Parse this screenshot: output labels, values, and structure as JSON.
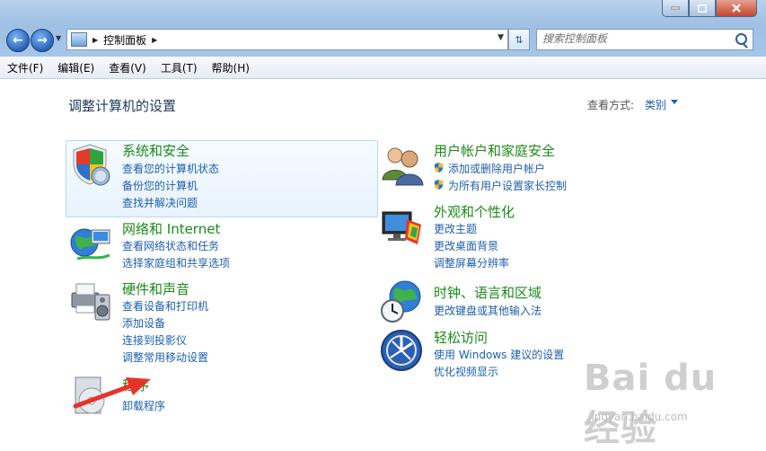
{
  "address": {
    "crumbs": [
      "控制面板"
    ]
  },
  "search": {
    "placeholder": "搜索控制面板"
  },
  "menu": [
    "文件(F)",
    "编辑(E)",
    "查看(V)",
    "工具(T)",
    "帮助(H)"
  ],
  "page": {
    "title": "调整计算机的设置",
    "view_by_label": "查看方式:",
    "view_by_value": "类别"
  },
  "categories": [
    {
      "title": "系统和安全",
      "links": [
        "查看您的计算机状态",
        "备份您的计算机",
        "查找并解决问题"
      ]
    },
    {
      "title": "网络和 Internet",
      "links": [
        "查看网络状态和任务",
        "选择家庭组和共享选项"
      ]
    },
    {
      "title": "硬件和声音",
      "links": [
        "查看设备和打印机",
        "添加设备",
        "连接到投影仪",
        "调整常用移动设置"
      ]
    },
    {
      "title": "程序",
      "links": [
        "卸载程序"
      ]
    },
    {
      "title": "用户帐户和家庭安全",
      "links": [
        "添加或删除用户帐户",
        "为所有用户设置家长控制"
      ]
    },
    {
      "title": "外观和个性化",
      "links": [
        "更改主题",
        "更改桌面背景",
        "调整屏幕分辨率"
      ]
    },
    {
      "title": "时钟、语言和区域",
      "links": [
        "更改键盘或其他输入法"
      ]
    },
    {
      "title": "轻松访问",
      "links": [
        "使用 Windows 建议的设置",
        "优化视频显示"
      ]
    }
  ],
  "watermark": {
    "main": "Bai du 经验",
    "sub": "jingyan.baidu.com"
  },
  "colors": {
    "category_title": "#1c8a19",
    "link": "#1e5fb0",
    "title": "#1e395b"
  }
}
